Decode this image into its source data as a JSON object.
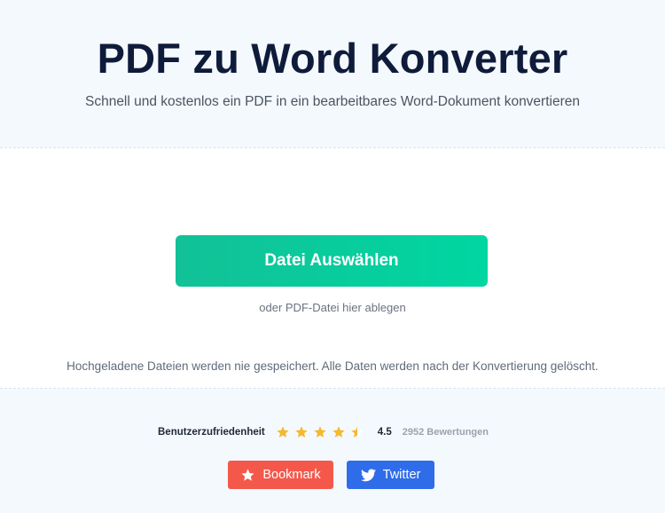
{
  "header": {
    "title": "PDF zu Word Konverter",
    "subtitle": "Schnell und kostenlos ein PDF in ein bearbeitbares Word-Dokument konvertieren"
  },
  "upload": {
    "button_label": "Datei Auswählen",
    "drop_hint": "oder PDF-Datei hier ablegen",
    "privacy_note": "Hochgeladene Dateien werden nie gespeichert. Alle Daten werden nach der Konvertierung gelöscht."
  },
  "rating": {
    "label": "Benutzerzufriedenheit",
    "score": "4.5",
    "count": "2952 Bewertungen",
    "stars_value": 4.5,
    "stars_max": 5,
    "star_color": "#f5b82e"
  },
  "share": {
    "bookmark_label": "Bookmark",
    "twitter_label": "Twitter",
    "bookmark_icon": "star-icon",
    "twitter_icon": "twitter-bird-icon"
  },
  "colors": {
    "primary_button": "#00d6a1",
    "bookmark_button": "#f3584b",
    "twitter_button": "#2f6ce9",
    "title_text": "#0f1b3a"
  }
}
